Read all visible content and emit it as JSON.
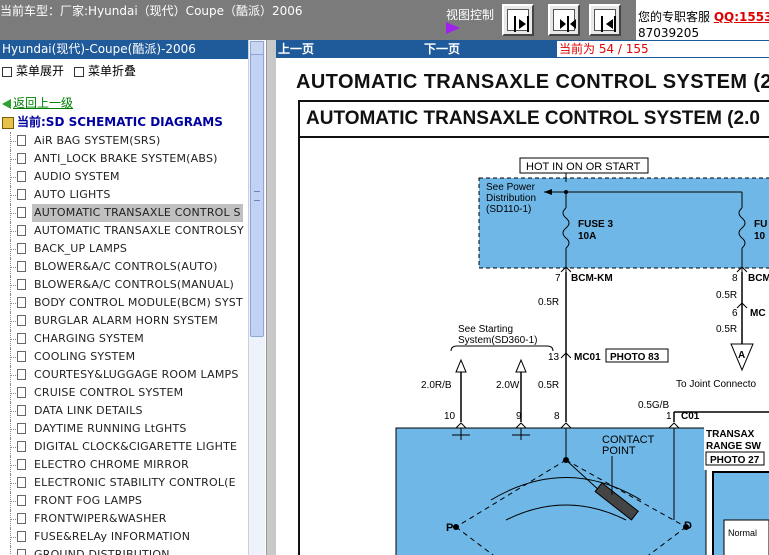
{
  "header": {
    "car_label": "当前车型：厂家:Hyundai（现代）Coupe（酷派）2006",
    "view_control_label": "视图控制",
    "support_label": "您的专职客服",
    "qq_label": "QQ:1553",
    "phone": "87039205"
  },
  "left_panel": {
    "title": "Hyundai(现代)-Coupe(酷派)-2006",
    "expand_label": "菜单展开",
    "collapse_label": "菜单折叠",
    "back_label": "返回上一级",
    "current_label": "当前:SD SCHEMATIC DIAGRAMS",
    "items": [
      "AiR BAG SYSTEM(SRS)",
      "ANTI_LOCK BRAKE SYSTEM(ABS)",
      "AUDIO SYSTEM",
      "AUTO LIGHTS",
      "AUTOMATIC TRANSAXLE CONTROL S",
      "AUTOMATIC TRANSAXLE CONTROLSY",
      "BACK_UP LAMPS",
      "BLOWER&A/C CONTROLS(AUTO)",
      "BLOWER&A/C CONTROLS(MANUAL)",
      "BODY CONTROL MODULE(BCM) SYST",
      "BURGLAR ALARM HORN SYSTEM",
      "CHARGING SYSTEM",
      "COOLING SYSTEM",
      "COURTESY&LUGGAGE ROOM LAMPS",
      "CRUISE CONTROL SYSTEM",
      "DATA LINK DETAILS",
      "DAYTIME RUNNING LtGHTS",
      "DIGITAL CLOCK&CIGARETTE LIGHTE",
      "ELECTRO CHROME MIRROR",
      "ELECTRONIC STABILITY CONTROL(E",
      "FRONT FOG LAMPS",
      "FRONTWIPER&WASHER",
      "FUSE&RELAy INFORMATION",
      "GROUND DISTRIBUTION"
    ],
    "selected_index": 4
  },
  "viewer": {
    "prev_label": "上一页",
    "next_label": "下一页",
    "page_label": "当前为  54 / 155"
  },
  "diagram": {
    "sheet_title": "AUTOMATIC TRANSAXLE CONTROL SYSTEM (2.0",
    "frame_title": "AUTOMATIC TRANSAXLE CONTROL SYSTEM (2.0",
    "hot_label": "HOT IN ON OR START",
    "see_power_1": "See Power",
    "see_power_2": "Distribution",
    "see_power_3": "(SD110-1)",
    "fuse3_label": "FUSE 3",
    "fuse3_amp": "10A",
    "fuse_right_label": "FU",
    "fuse_right_amp": "10",
    "pin7": "7",
    "bcm_km": "BCM-KM",
    "pin8_top": "8",
    "bcm_right": "BCM",
    "wire_05r_a": "0.5R",
    "wire_05r_b": "0.5R",
    "wire_05r_c": "0.5R",
    "wire_05r_d": "0.5R",
    "pin6": "6",
    "mc_right": "MC",
    "see_starting_1": "See Starting",
    "see_starting_2": "System(SD360-1)",
    "pin13": "13",
    "mc01": "MC01",
    "photo83": "PHOTO 83",
    "connector_a": "A",
    "joint_label": "To Joint Connecto",
    "wire_20rb": "2.0R/B",
    "wire_20w": "2.0W",
    "wire_05gb": "0.5G/B",
    "pin10": "10",
    "pin9": "9",
    "pin8_bot": "8",
    "pin1": "1",
    "c01": "C01",
    "transaxle_1": "TRANSAX",
    "transaxle_2": "RANGE SW",
    "photo27": "PHOTO 27",
    "contact_1": "CONTACT",
    "contact_2": "POINT",
    "p_label": "P",
    "d_label": "D",
    "normal_label": "Normal"
  }
}
